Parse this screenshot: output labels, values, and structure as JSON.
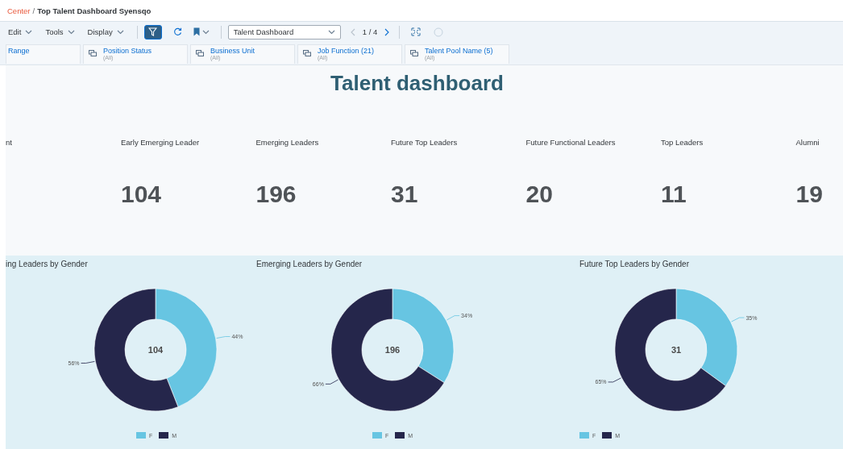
{
  "breadcrumb": {
    "link": "Center",
    "separator": "/",
    "title": "Top Talent Dashboard Syensqo"
  },
  "toolbar": {
    "menus": [
      {
        "label": "Edit"
      },
      {
        "label": "Tools"
      },
      {
        "label": "Display"
      }
    ],
    "filter_on": true,
    "dropdown": {
      "value": "Talent Dashboard"
    },
    "pager": "1 / 4",
    "last_disabled": true
  },
  "filters": [
    {
      "kind": "partial",
      "label": "Range"
    },
    {
      "kind": "full",
      "label": "Position Status",
      "value": "(All)"
    },
    {
      "kind": "full",
      "label": "Business Unit",
      "value": "(All)"
    },
    {
      "kind": "full",
      "label": "Job Function (21)",
      "value": "(All)"
    },
    {
      "kind": "full",
      "label": "Talent Pool Name (5)",
      "value": "(All)"
    }
  ],
  "dashboard": {
    "title": "Talent dashboard",
    "kpis": [
      {
        "label": "nt"
      },
      {
        "label": "Early Emerging Leader",
        "value": "104"
      },
      {
        "label": "Emerging Leaders",
        "value": "196"
      },
      {
        "label": "Future Top Leaders",
        "value": "31"
      },
      {
        "label": "Future Functional Leaders",
        "value": "20"
      },
      {
        "label": "Top Leaders",
        "value": "11"
      },
      {
        "label": "Alumni",
        "value": "19"
      }
    ]
  },
  "charts": [
    {
      "center_label": "104",
      "legend": [
        {
          "label": "F",
          "color": "#67c5e2"
        },
        {
          "label": "M",
          "color": "#25264b"
        }
      ],
      "chart_data": {
        "type": "donut",
        "title": "ing Leaders by Gender",
        "values": [
          44,
          56
        ],
        "value_labels": [
          "44%",
          "56%"
        ]
      }
    },
    {
      "center_label": "196",
      "legend": [
        {
          "label": "F",
          "color": "#67c5e2"
        },
        {
          "label": "M",
          "color": "#25264b"
        }
      ],
      "chart_data": {
        "type": "donut",
        "title": "Emerging Leaders by Gender",
        "values": [
          34,
          66
        ],
        "value_labels": [
          "34%",
          "66%"
        ]
      }
    },
    {
      "center_label": "31",
      "legend": [
        {
          "label": "F",
          "color": "#67c5e2"
        },
        {
          "label": "M",
          "color": "#25264b"
        }
      ],
      "chart_data": {
        "type": "donut",
        "title": "Future Top Leaders by Gender",
        "values": [
          35,
          65
        ],
        "value_labels": [
          "35%",
          "65%"
        ]
      }
    }
  ]
}
